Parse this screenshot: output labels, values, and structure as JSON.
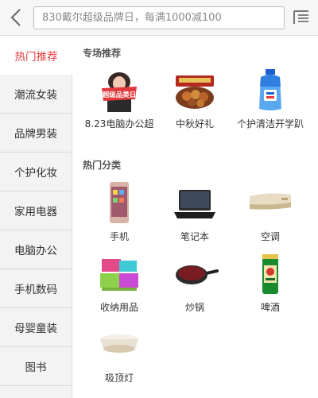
{
  "search": {
    "placeholder": "830戴尔超级品牌日，每满1000减100"
  },
  "sidebar": {
    "items": [
      {
        "label": "热门推荐",
        "active": true
      },
      {
        "label": "潮流女装",
        "active": false
      },
      {
        "label": "品牌男装",
        "active": false
      },
      {
        "label": "个护化妆",
        "active": false
      },
      {
        "label": "家用电器",
        "active": false
      },
      {
        "label": "电脑办公",
        "active": false
      },
      {
        "label": "手机数码",
        "active": false
      },
      {
        "label": "母婴童装",
        "active": false
      },
      {
        "label": "图书",
        "active": false
      }
    ]
  },
  "sections": {
    "featured": {
      "title": "专场推荐",
      "items": [
        {
          "label": "8.23电脑办公超",
          "icon": "super-brand-day-promo",
          "badge": "超级品类日"
        },
        {
          "label": "中秋好礼",
          "icon": "mid-autumn-gift-box"
        },
        {
          "label": "个护清洁开学趴",
          "icon": "detergent-bottle"
        }
      ]
    },
    "hot": {
      "title": "热门分类",
      "items": [
        {
          "label": "手机",
          "icon": "phone-image"
        },
        {
          "label": "笔记本",
          "icon": "laptop-image"
        },
        {
          "label": "空调",
          "icon": "air-conditioner-image"
        },
        {
          "label": "收纳用品",
          "icon": "storage-boxes-image"
        },
        {
          "label": "炒锅",
          "icon": "wok-image"
        },
        {
          "label": "啤酒",
          "icon": "beer-image"
        },
        {
          "label": "吸顶灯",
          "icon": "ceiling-lamp-image"
        }
      ]
    }
  },
  "colors": {
    "accent": "#e4393c",
    "sidebar_bg": "#f3f3f3",
    "header_bg": "#f6f6f6"
  }
}
